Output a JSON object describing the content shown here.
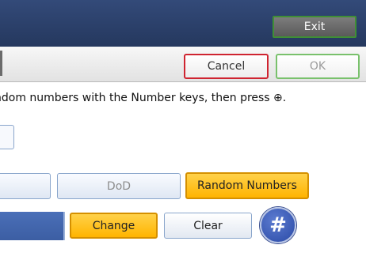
{
  "header": {
    "exit_label": "Exit"
  },
  "toolbar": {
    "cancel_label": "Cancel",
    "ok_label": "OK"
  },
  "instruction": {
    "text": "ndom numbers with the Number keys, then press ⊕."
  },
  "type_buttons": {
    "dod_label": "DoD",
    "random_label": "Random Numbers"
  },
  "actions": {
    "change_label": "Change",
    "clear_label": "Clear",
    "hash_label": "#"
  },
  "colors": {
    "header_bg": "#2c416b",
    "selected_orange": "#ffc21a",
    "cancel_border": "#cf2430",
    "ok_border": "#79c16c",
    "exit_border": "#3f8f35"
  }
}
